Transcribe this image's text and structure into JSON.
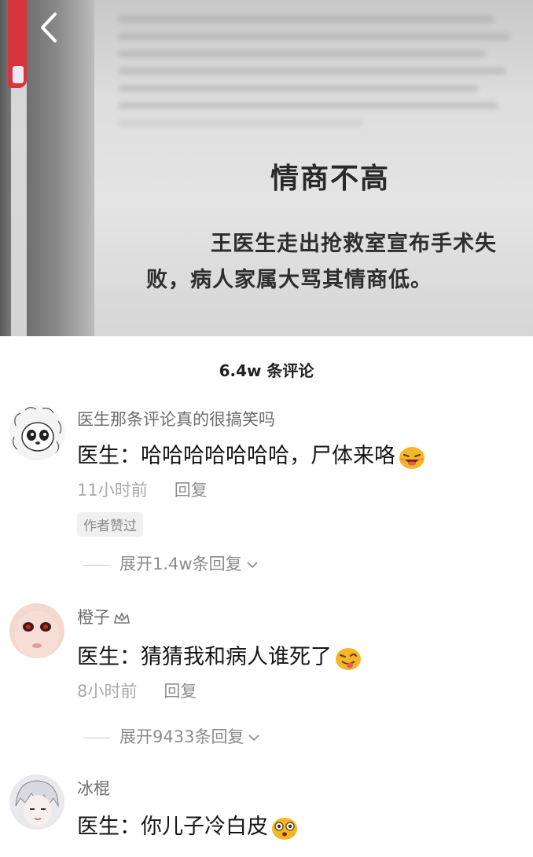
{
  "video": {
    "book_title": "情商不高",
    "book_body": "王医生走出抢救室宣布手术失败，病人家属大骂其情商低。"
  },
  "comments_header": {
    "count_label": "6.4w 条评论"
  },
  "comments": [
    {
      "username": "医生那条评论真的很搞笑吗",
      "text": "医生：哈哈哈哈哈哈哈，尸体来咯",
      "time": "11小时前",
      "reply_label": "回复",
      "badge": "作者赞过",
      "expand_label": "展开1.4w条回复",
      "emoji_icon": "grinning-emoji-icon"
    },
    {
      "username": "橙子",
      "text": "医生：猜猜我和病人谁死了",
      "time": "8小时前",
      "reply_label": "回复",
      "expand_label": "展开9433条回复",
      "emoji_icon": "winking-tongue-emoji-icon"
    },
    {
      "username": "冰棍",
      "text": "医生：你儿子冷白皮",
      "emoji_icon": "surprised-emoji-icon"
    }
  ],
  "colors": {
    "text_primary": "#161616",
    "text_secondary": "#6c6c6c",
    "text_muted": "#a9a9a9",
    "emoji_yellow": "#f5b626"
  }
}
